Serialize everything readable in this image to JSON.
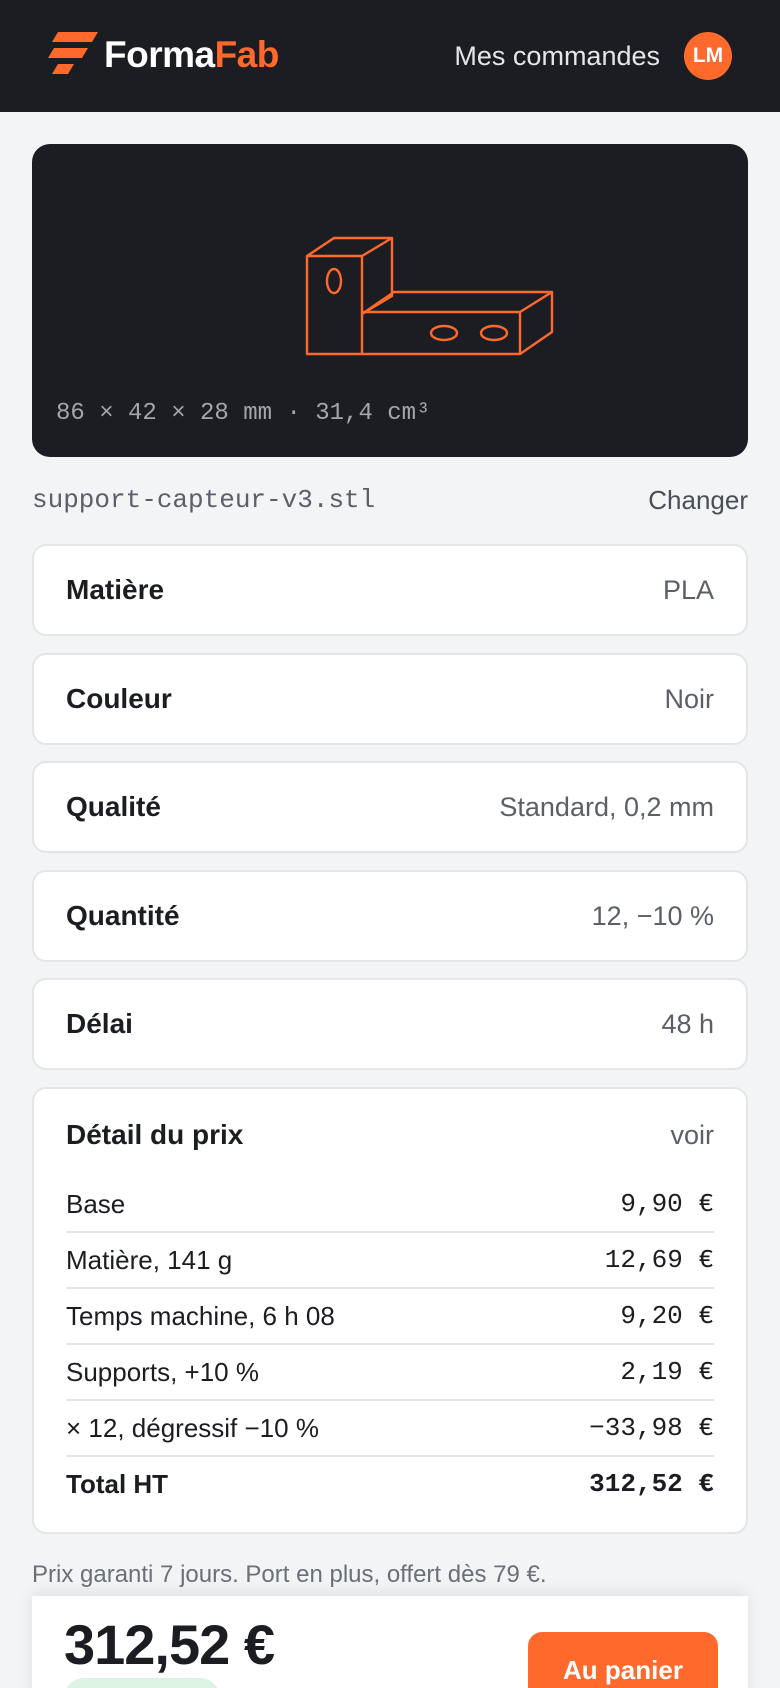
{
  "header": {
    "brand_part1": "Forma",
    "brand_part2": "Fab",
    "orders_link": "Mes commandes",
    "avatar_initials": "LM"
  },
  "preview": {
    "dimensions": "86 × 42 × 28 mm · 31,4 cm³"
  },
  "file": {
    "name": "support-capteur-v3.stl",
    "change_label": "Changer"
  },
  "options": [
    {
      "label": "Matière",
      "value": "PLA"
    },
    {
      "label": "Couleur",
      "value": "Noir"
    },
    {
      "label": "Qualité",
      "value": "Standard, 0,2 mm"
    },
    {
      "label": "Quantité",
      "value": "12, −10 %"
    },
    {
      "label": "Délai",
      "value": "48 h"
    }
  ],
  "price_detail": {
    "title": "Détail du prix",
    "toggle": "voir",
    "lines": [
      {
        "label": "Base",
        "amount": "9,90 €"
      },
      {
        "label": "Matière, 141 g",
        "amount": "12,69 €"
      },
      {
        "label": "Temps machine, 6 h 08",
        "amount": "9,20 €"
      },
      {
        "label": "Supports, +10 %",
        "amount": "2,19 €"
      },
      {
        "label": "× 12, dégressif −10 %",
        "amount": "−33,98 €"
      },
      {
        "label": "Total HT",
        "amount": "312,52 €"
      }
    ]
  },
  "note": "Prix garanti 7 jours. Port en plus, offert dès 79 €.",
  "footer": {
    "total": "312,52 €",
    "cart_button": "Au panier"
  },
  "colors": {
    "accent": "#ff6a2c",
    "dark": "#1b1d22",
    "background": "#f3f4f6"
  }
}
